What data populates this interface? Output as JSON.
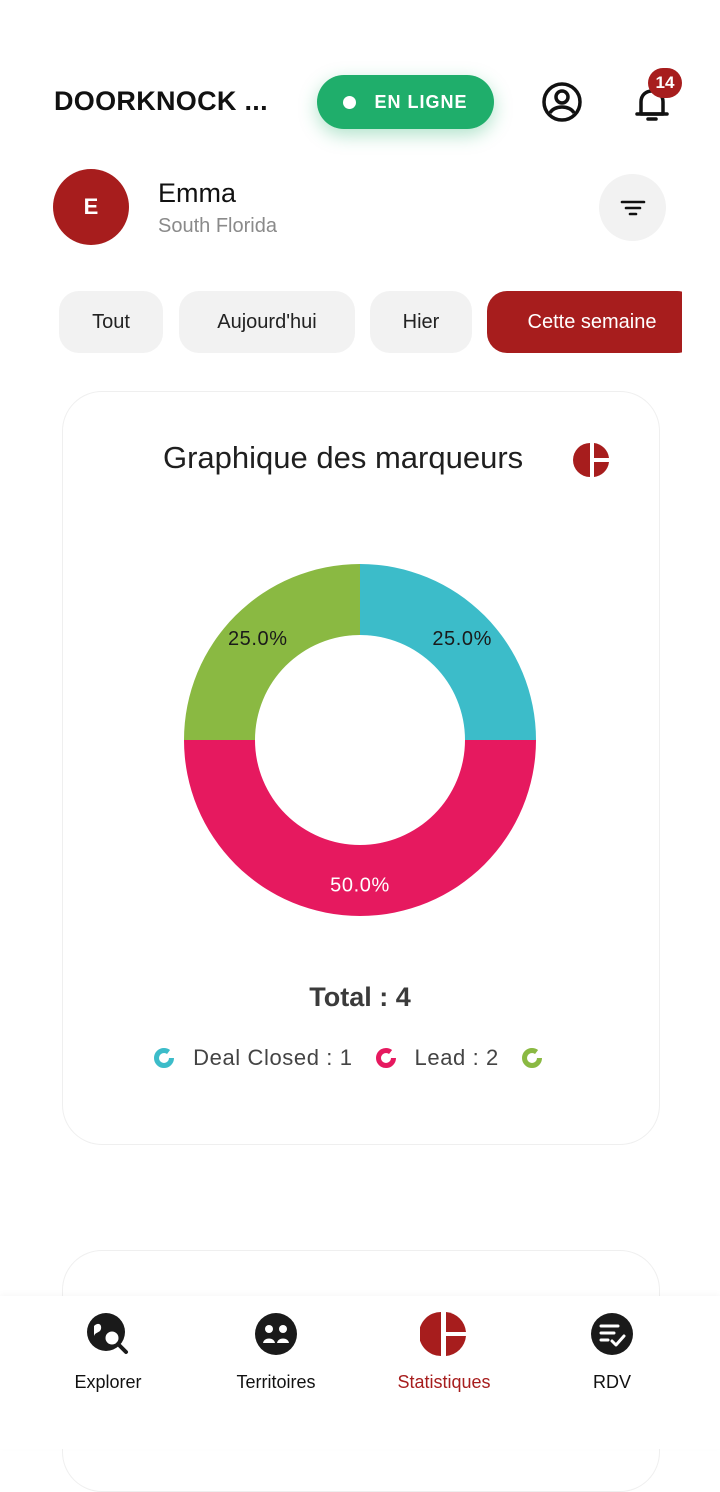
{
  "header": {
    "app_title": "DOORKNOCK ...",
    "status_label": "EN LIGNE",
    "notifications_count": "14"
  },
  "profile": {
    "initial": "E",
    "name": "Emma",
    "region": "South Florida"
  },
  "tabs": [
    {
      "label": "Tout",
      "active": false
    },
    {
      "label": "Aujourd'hui",
      "active": false
    },
    {
      "label": "Hier",
      "active": false
    },
    {
      "label": "Cette semaine",
      "active": true
    }
  ],
  "card": {
    "title": "Graphique des marqueurs",
    "total_label": "Total : 4",
    "legend": [
      {
        "label": "Deal Closed : 1",
        "color": "#3cbcc9"
      },
      {
        "label": "Lead : 2",
        "color": "#e6195f"
      },
      {
        "label": "",
        "color": "#8ab942"
      }
    ]
  },
  "chart_data": {
    "type": "pie",
    "title": "Graphique des marqueurs",
    "donut": true,
    "slices": [
      {
        "name": "Deal Closed",
        "value": 1,
        "label": "25.0%",
        "color": "#3cbcc9"
      },
      {
        "name": "Lead",
        "value": 2,
        "label": "50.0%",
        "color": "#e6195f"
      },
      {
        "name": "",
        "value": 1,
        "label": "25.0%",
        "color": "#8ab942"
      }
    ]
  },
  "bottom_nav": [
    {
      "label": "Explorer",
      "icon": "explore-icon",
      "active": false
    },
    {
      "label": "Territoires",
      "icon": "territories-icon",
      "active": false
    },
    {
      "label": "Statistiques",
      "icon": "pie-chart-icon",
      "active": true
    },
    {
      "label": "RDV",
      "icon": "appointment-icon",
      "active": false
    }
  ],
  "colors": {
    "brand": "#a71d1d",
    "online": "#1fae6b"
  }
}
